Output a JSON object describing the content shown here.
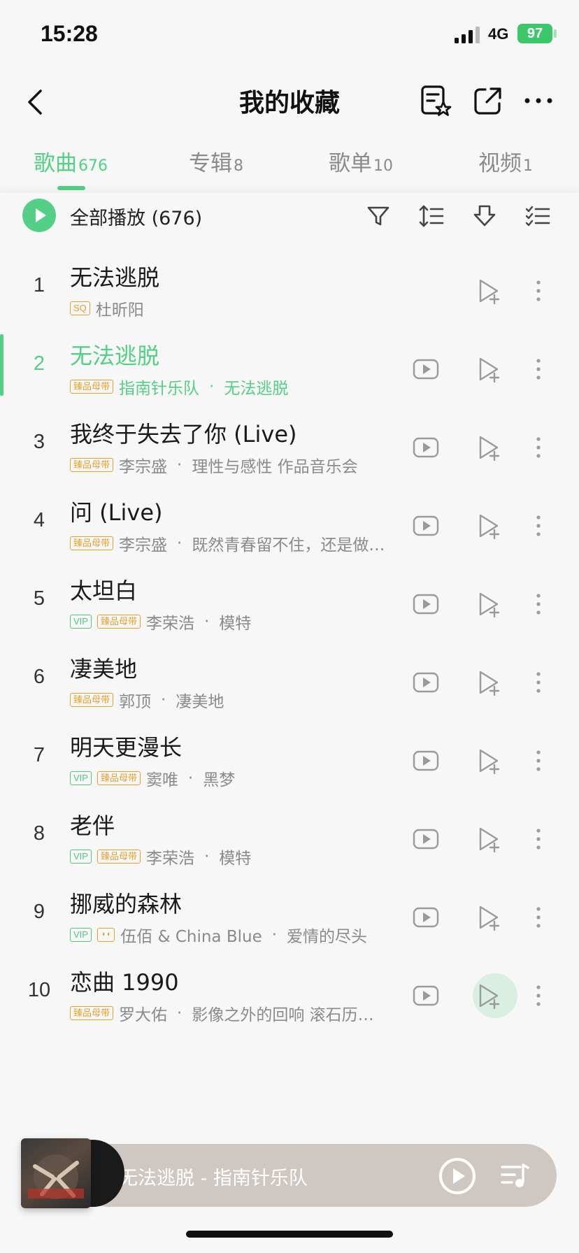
{
  "status_bar": {
    "time": "15:28",
    "network": "4G",
    "battery": "97"
  },
  "nav": {
    "title": "我的收藏"
  },
  "tabs": [
    {
      "label": "歌曲",
      "count": "676",
      "active": true
    },
    {
      "label": "专辑",
      "count": "8",
      "active": false
    },
    {
      "label": "歌单",
      "count": "10",
      "active": false
    },
    {
      "label": "视频",
      "count": "1",
      "active": false
    }
  ],
  "toolbar": {
    "play_all_label": "全部播放 (676)"
  },
  "badges": {
    "sq": "SQ",
    "master": "臻品母带",
    "vip": "VIP",
    "dolby": "◗◖"
  },
  "songs": [
    {
      "index": "1",
      "title": "无法逃脱",
      "artist": "杜昕阳",
      "album": "",
      "badges": [
        "sq"
      ],
      "has_mv": false
    },
    {
      "index": "2",
      "title": "无法逃脱",
      "artist": "指南针乐队",
      "album": "无法逃脱",
      "badges": [
        "master"
      ],
      "has_mv": true,
      "playing": true
    },
    {
      "index": "3",
      "title": "我终于失去了你 (Live)",
      "artist": "李宗盛",
      "album": "理性与感性 作品音乐会",
      "badges": [
        "master"
      ],
      "has_mv": true
    },
    {
      "index": "4",
      "title": "问 (Live)",
      "artist": "李宗盛",
      "album": "既然青春留不住，还是做…",
      "badges": [
        "master"
      ],
      "has_mv": true
    },
    {
      "index": "5",
      "title": "太坦白",
      "artist": "李荣浩",
      "album": "模特",
      "badges": [
        "vip",
        "master"
      ],
      "has_mv": true
    },
    {
      "index": "6",
      "title": "凄美地",
      "artist": "郭顶",
      "album": "凄美地",
      "badges": [
        "master"
      ],
      "has_mv": true
    },
    {
      "index": "7",
      "title": "明天更漫长",
      "artist": "窦唯",
      "album": "黑梦",
      "badges": [
        "vip",
        "master"
      ],
      "has_mv": true
    },
    {
      "index": "8",
      "title": "老伴",
      "artist": "李荣浩",
      "album": "模特",
      "badges": [
        "vip",
        "master"
      ],
      "has_mv": true
    },
    {
      "index": "9",
      "title": "挪威的森林",
      "artist": "伍佰 & China Blue",
      "album": "爱情的尽头",
      "badges": [
        "vip",
        "dolby"
      ],
      "has_mv": true
    },
    {
      "index": "10",
      "title": "恋曲 1990",
      "artist": "罗大佑",
      "album": "影像之外的回响 滚石历…",
      "badges": [
        "master"
      ],
      "has_mv": true,
      "add_active": true
    }
  ],
  "mini_player": {
    "now_playing": "无法逃脱 - 指南针乐队"
  },
  "colors": {
    "accent": "#54cf86",
    "badge_gold": "#e0a32e",
    "muted_text": "#8a8a8a",
    "mini_player_bg": "#cfc7c2"
  }
}
